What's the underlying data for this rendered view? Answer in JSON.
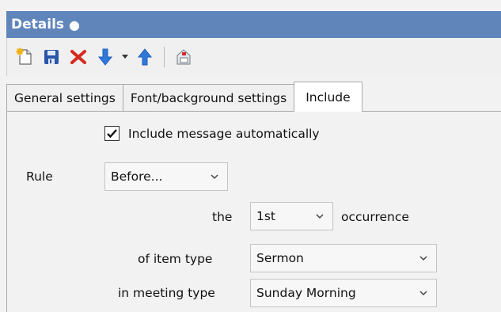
{
  "header": {
    "title": "Details",
    "dot": "●"
  },
  "toolbar": {
    "items": [
      {
        "name": "new-item-icon"
      },
      {
        "name": "save-icon"
      },
      {
        "name": "delete-icon"
      },
      {
        "name": "move-down-icon"
      },
      {
        "name": "move-up-icon"
      },
      {
        "name": "print-icon"
      }
    ]
  },
  "tabs": [
    {
      "label": "General settings",
      "active": false
    },
    {
      "label": "Font/background settings",
      "active": false
    },
    {
      "label": "Include",
      "active": true
    }
  ],
  "form": {
    "include_auto": {
      "checked": true,
      "label": "Include message automatically"
    },
    "rule": {
      "label": "Rule",
      "value": "Before..."
    },
    "occurrence": {
      "label_before": "the",
      "value": "1st",
      "label_after": "occurrence"
    },
    "item_type": {
      "label": "of item type",
      "value": "Sermon"
    },
    "meeting_type": {
      "label": "in meeting type",
      "value": "Sunday Morning"
    }
  },
  "colors": {
    "header_bg": "#5f85bb",
    "delete_red": "#d42a1e",
    "arrow_blue": "#2f78d8",
    "save_blue": "#2a55a8"
  }
}
